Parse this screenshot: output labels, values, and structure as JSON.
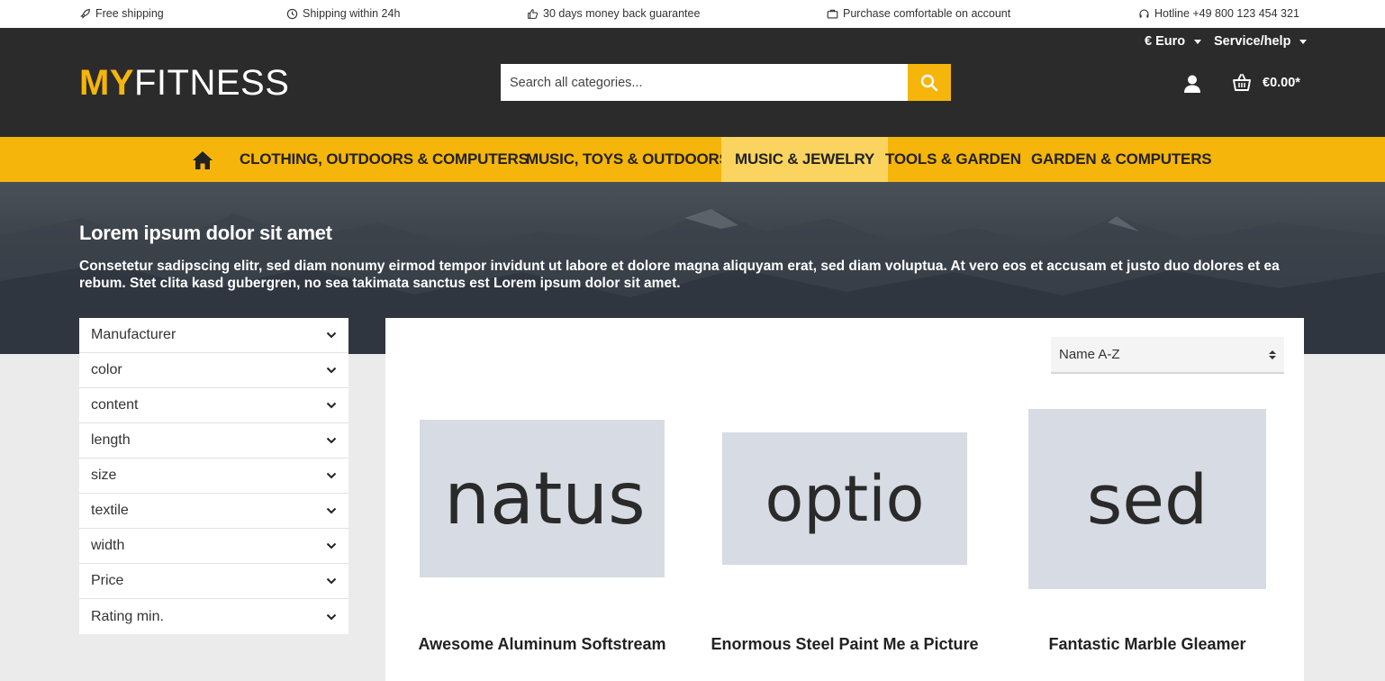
{
  "topbar": {
    "free_shipping": "Free shipping",
    "shipping_24h": "Shipping within 24h",
    "money_back": "30 days money back guarantee",
    "account_purchase": "Purchase comfortable on account",
    "hotline": "Hotline +49 800 123 454 321"
  },
  "header": {
    "logo_my": "MY",
    "logo_fitness": "FITNESS",
    "currency": "€ Euro",
    "service": "Service/help",
    "search_placeholder": "Search all categories...",
    "cart_total": "€0.00*"
  },
  "nav": {
    "items": [
      {
        "label": "CLOTHING, OUTDOORS & COMPUTERS",
        "active": false
      },
      {
        "label": "MUSIC, TOYS & OUTDOORS",
        "active": false
      },
      {
        "label": "MUSIC & JEWELRY",
        "active": true
      },
      {
        "label": "TOOLS & GARDEN",
        "active": false
      },
      {
        "label": "GARDEN & COMPUTERS",
        "active": false
      }
    ]
  },
  "hero": {
    "title": "Lorem ipsum dolor sit amet",
    "text": "Consetetur sadipscing elitr, sed diam nonumy eirmod tempor invidunt ut labore et dolore magna aliquyam erat, sed diam voluptua. At vero eos et accusam et justo duo dolores et ea rebum. Stet clita kasd gubergren, no sea takimata sanctus est Lorem ipsum dolor sit amet."
  },
  "filters": [
    "Manufacturer",
    "color",
    "content",
    "length",
    "size",
    "textile",
    "width",
    "Price",
    "Rating min."
  ],
  "sort": {
    "selected": "Name A-Z"
  },
  "products": [
    {
      "image_text": "natus",
      "title": "Awesome Aluminum Softstream"
    },
    {
      "image_text": "optio",
      "title": "Enormous Steel Paint Me a Picture"
    },
    {
      "image_text": "sed",
      "title": "Fantastic Marble Gleamer"
    }
  ],
  "colors": {
    "accent": "#f5b50a",
    "header_bg": "#2b2b2b",
    "nav_active": "#fad45f"
  }
}
